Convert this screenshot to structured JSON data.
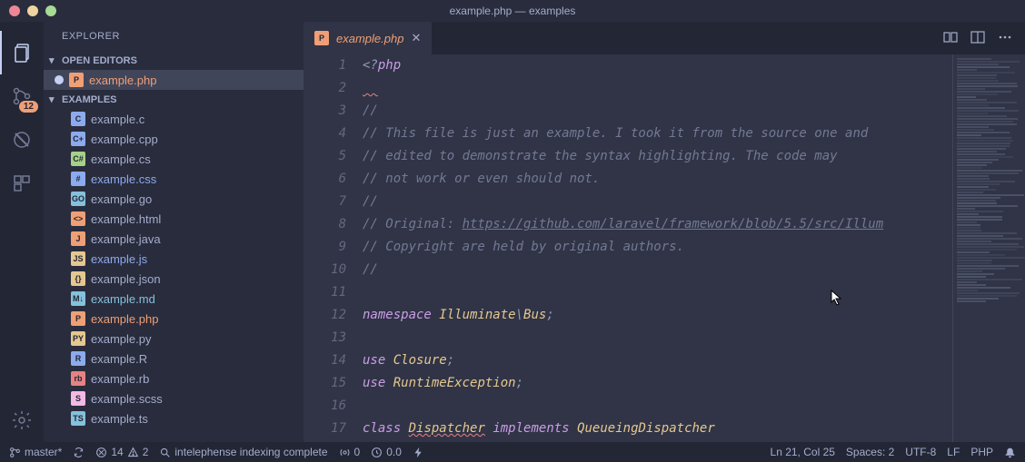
{
  "window": {
    "title": "example.php — examples"
  },
  "sidebar": {
    "title": "EXPLORER",
    "openEditors": {
      "header": "OPEN EDITORS",
      "items": [
        {
          "name": "example.php",
          "iconColor": "#ef9f76"
        }
      ]
    },
    "folder": {
      "header": "EXAMPLES"
    },
    "files": [
      {
        "name": "example.c",
        "iconBg": "#8caaee",
        "iconText": "C"
      },
      {
        "name": "example.cpp",
        "iconBg": "#8caaee",
        "iconText": "C+"
      },
      {
        "name": "example.cs",
        "iconBg": "#a6d189",
        "iconText": "C#"
      },
      {
        "name": "example.css",
        "iconBg": "#8caaee",
        "iconText": "#",
        "hl": "css"
      },
      {
        "name": "example.go",
        "iconBg": "#85c1dc",
        "iconText": "GO"
      },
      {
        "name": "example.html",
        "iconBg": "#ef9f76",
        "iconText": "<>"
      },
      {
        "name": "example.java",
        "iconBg": "#ef9f76",
        "iconText": "J"
      },
      {
        "name": "example.js",
        "iconBg": "#e5c890",
        "iconText": "JS",
        "hl": "js"
      },
      {
        "name": "example.json",
        "iconBg": "#e5c890",
        "iconText": "{}"
      },
      {
        "name": "example.md",
        "iconBg": "#85c1dc",
        "iconText": "M↓",
        "hl": "md"
      },
      {
        "name": "example.php",
        "iconBg": "#ef9f76",
        "iconText": "P",
        "hl": "php"
      },
      {
        "name": "example.py",
        "iconBg": "#e5c890",
        "iconText": "PY"
      },
      {
        "name": "example.R",
        "iconBg": "#8caaee",
        "iconText": "R"
      },
      {
        "name": "example.rb",
        "iconBg": "#e78284",
        "iconText": "rb"
      },
      {
        "name": "example.scss",
        "iconBg": "#f4b8e4",
        "iconText": "S"
      },
      {
        "name": "example.ts",
        "iconBg": "#85c1dc",
        "iconText": "TS"
      }
    ]
  },
  "activityBadge": "12",
  "tab": {
    "label": "example.php"
  },
  "code": {
    "lines": [
      {
        "n": 1,
        "html": "<span class='tok-punct'>&lt;?</span><span class='tok-keyword'>php</span>"
      },
      {
        "n": 2,
        "html": "<span class='squiggle' style='color:#737994'>  </span>"
      },
      {
        "n": 3,
        "html": "<span class='tok-comment'>//</span>"
      },
      {
        "n": 4,
        "html": "<span class='tok-comment'>// This file is just an example. I took it from the source one and</span>"
      },
      {
        "n": 5,
        "html": "<span class='tok-comment'>// edited to demonstrate the syntax highlighting. The code may</span>"
      },
      {
        "n": 6,
        "html": "<span class='tok-comment'>// not work or even should not.</span>"
      },
      {
        "n": 7,
        "html": "<span class='tok-comment'>//</span>"
      },
      {
        "n": 8,
        "html": "<span class='tok-comment'>// Original: <span class='tok-link'>https://github.com/laravel/framework/blob/5.5/src/Illum</span></span>"
      },
      {
        "n": 9,
        "html": "<span class='tok-comment'>// Copyright are held by original authors.</span>"
      },
      {
        "n": 10,
        "html": "<span class='tok-comment'>//</span>"
      },
      {
        "n": 11,
        "html": ""
      },
      {
        "n": 12,
        "html": "<span class='tok-keyword'>namespace</span> <span class='tok-class'>Illuminate</span><span class='tok-punct'>\\</span><span class='tok-class'>Bus</span><span class='tok-punct'>;</span>"
      },
      {
        "n": 13,
        "html": ""
      },
      {
        "n": 14,
        "html": "<span class='tok-keyword'>use</span> <span class='tok-class'>Closure</span><span class='tok-punct'>;</span>"
      },
      {
        "n": 15,
        "html": "<span class='tok-keyword'>use</span> <span class='tok-class'>RuntimeException</span><span class='tok-punct'>;</span>"
      },
      {
        "n": 16,
        "html": ""
      },
      {
        "n": 17,
        "html": "<span class='tok-keyword'>class</span> <span class='tok-class squiggle'>Dispatcher</span> <span class='tok-keyword'>implements</span> <span class='tok-class'>QueueingDispatcher</span>"
      }
    ]
  },
  "status": {
    "branch": "master*",
    "errors": "14",
    "warnings": "2",
    "search": "intelephense indexing complete",
    "radio": "0",
    "clock": "0.0",
    "cursor": "Ln 21, Col 25",
    "spaces": "Spaces: 2",
    "encoding": "UTF-8",
    "eol": "LF",
    "lang": "PHP"
  }
}
